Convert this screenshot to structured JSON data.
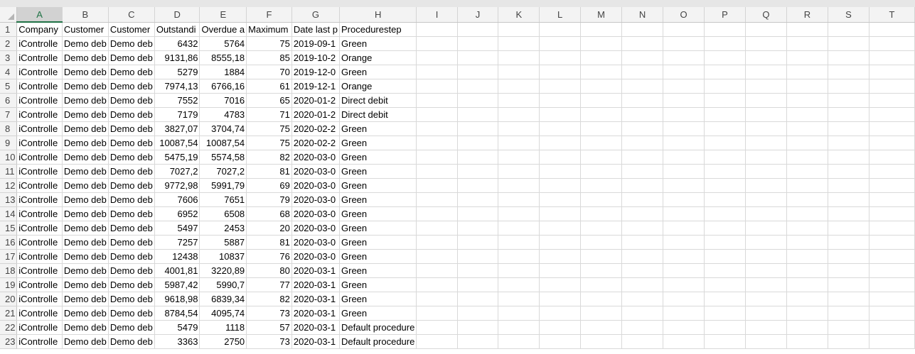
{
  "sheet": {
    "columns": [
      "A",
      "B",
      "C",
      "D",
      "E",
      "F",
      "G",
      "H",
      "I",
      "J",
      "K",
      "L",
      "M",
      "N",
      "O",
      "P",
      "Q",
      "R",
      "S",
      "T"
    ],
    "active_column": "A",
    "header_row": {
      "row_number": "1",
      "A": "Company",
      "B": "Customer",
      "C": "Customer",
      "D": "Outstandi",
      "E": "Overdue a",
      "F": "Maximum",
      "G": "Date last p",
      "H": "Procedurestep"
    },
    "rows": [
      {
        "n": "2",
        "A": "iControlle",
        "B": "Demo deb",
        "C": "Demo deb",
        "D": "6432",
        "E": "5764",
        "F": "75",
        "G": "2019-09-1",
        "H": "Green"
      },
      {
        "n": "3",
        "A": "iControlle",
        "B": "Demo deb",
        "C": "Demo deb",
        "D": "9131,86",
        "E": "8555,18",
        "F": "85",
        "G": "2019-10-2",
        "H": "Orange"
      },
      {
        "n": "4",
        "A": "iControlle",
        "B": "Demo deb",
        "C": "Demo deb",
        "D": "5279",
        "E": "1884",
        "F": "70",
        "G": "2019-12-0",
        "H": "Green"
      },
      {
        "n": "5",
        "A": "iControlle",
        "B": "Demo deb",
        "C": "Demo deb",
        "D": "7974,13",
        "E": "6766,16",
        "F": "61",
        "G": "2019-12-1",
        "H": "Orange"
      },
      {
        "n": "6",
        "A": "iControlle",
        "B": "Demo deb",
        "C": "Demo deb",
        "D": "7552",
        "E": "7016",
        "F": "65",
        "G": "2020-01-2",
        "H": "Direct debit"
      },
      {
        "n": "7",
        "A": "iControlle",
        "B": "Demo deb",
        "C": "Demo deb",
        "D": "7179",
        "E": "4783",
        "F": "71",
        "G": "2020-01-2",
        "H": "Direct debit"
      },
      {
        "n": "8",
        "A": "iControlle",
        "B": "Demo deb",
        "C": "Demo deb",
        "D": "3827,07",
        "E": "3704,74",
        "F": "75",
        "G": "2020-02-2",
        "H": "Green"
      },
      {
        "n": "9",
        "A": "iControlle",
        "B": "Demo deb",
        "C": "Demo deb",
        "D": "10087,54",
        "E": "10087,54",
        "F": "75",
        "G": "2020-02-2",
        "H": "Green"
      },
      {
        "n": "10",
        "A": "iControlle",
        "B": "Demo deb",
        "C": "Demo deb",
        "D": "5475,19",
        "E": "5574,58",
        "F": "82",
        "G": "2020-03-0",
        "H": "Green"
      },
      {
        "n": "11",
        "A": "iControlle",
        "B": "Demo deb",
        "C": "Demo deb",
        "D": "7027,2",
        "E": "7027,2",
        "F": "81",
        "G": "2020-03-0",
        "H": "Green"
      },
      {
        "n": "12",
        "A": "iControlle",
        "B": "Demo deb",
        "C": "Demo deb",
        "D": "9772,98",
        "E": "5991,79",
        "F": "69",
        "G": "2020-03-0",
        "H": "Green"
      },
      {
        "n": "13",
        "A": "iControlle",
        "B": "Demo deb",
        "C": "Demo deb",
        "D": "7606",
        "E": "7651",
        "F": "79",
        "G": "2020-03-0",
        "H": "Green"
      },
      {
        "n": "14",
        "A": "iControlle",
        "B": "Demo deb",
        "C": "Demo deb",
        "D": "6952",
        "E": "6508",
        "F": "68",
        "G": "2020-03-0",
        "H": "Green"
      },
      {
        "n": "15",
        "A": "iControlle",
        "B": "Demo deb",
        "C": "Demo deb",
        "D": "5497",
        "E": "2453",
        "F": "20",
        "G": "2020-03-0",
        "H": "Green"
      },
      {
        "n": "16",
        "A": "iControlle",
        "B": "Demo deb",
        "C": "Demo deb",
        "D": "7257",
        "E": "5887",
        "F": "81",
        "G": "2020-03-0",
        "H": "Green"
      },
      {
        "n": "17",
        "A": "iControlle",
        "B": "Demo deb",
        "C": "Demo deb",
        "D": "12438",
        "E": "10837",
        "F": "76",
        "G": "2020-03-0",
        "H": "Green"
      },
      {
        "n": "18",
        "A": "iControlle",
        "B": "Demo deb",
        "C": "Demo deb",
        "D": "4001,81",
        "E": "3220,89",
        "F": "80",
        "G": "2020-03-1",
        "H": "Green"
      },
      {
        "n": "19",
        "A": "iControlle",
        "B": "Demo deb",
        "C": "Demo deb",
        "D": "5987,42",
        "E": "5990,7",
        "F": "77",
        "G": "2020-03-1",
        "H": "Green"
      },
      {
        "n": "20",
        "A": "iControlle",
        "B": "Demo deb",
        "C": "Demo deb",
        "D": "9618,98",
        "E": "6839,34",
        "F": "82",
        "G": "2020-03-1",
        "H": "Green"
      },
      {
        "n": "21",
        "A": "iControlle",
        "B": "Demo deb",
        "C": "Demo deb",
        "D": "8784,54",
        "E": "4095,74",
        "F": "73",
        "G": "2020-03-1",
        "H": "Green"
      },
      {
        "n": "22",
        "A": "iControlle",
        "B": "Demo deb",
        "C": "Demo deb",
        "D": "5479",
        "E": "1118",
        "F": "57",
        "G": "2020-03-1",
        "H": "Default procedure"
      },
      {
        "n": "23",
        "A": "iControlle",
        "B": "Demo deb",
        "C": "Demo deb",
        "D": "3363",
        "E": "2750",
        "F": "73",
        "G": "2020-03-1",
        "H": "Default procedure"
      }
    ],
    "colors": {
      "header_bg": "#f3f3f3",
      "active_header_bg": "#d2d2d2",
      "accent": "#217346",
      "gridline": "#d9d9d9"
    }
  }
}
